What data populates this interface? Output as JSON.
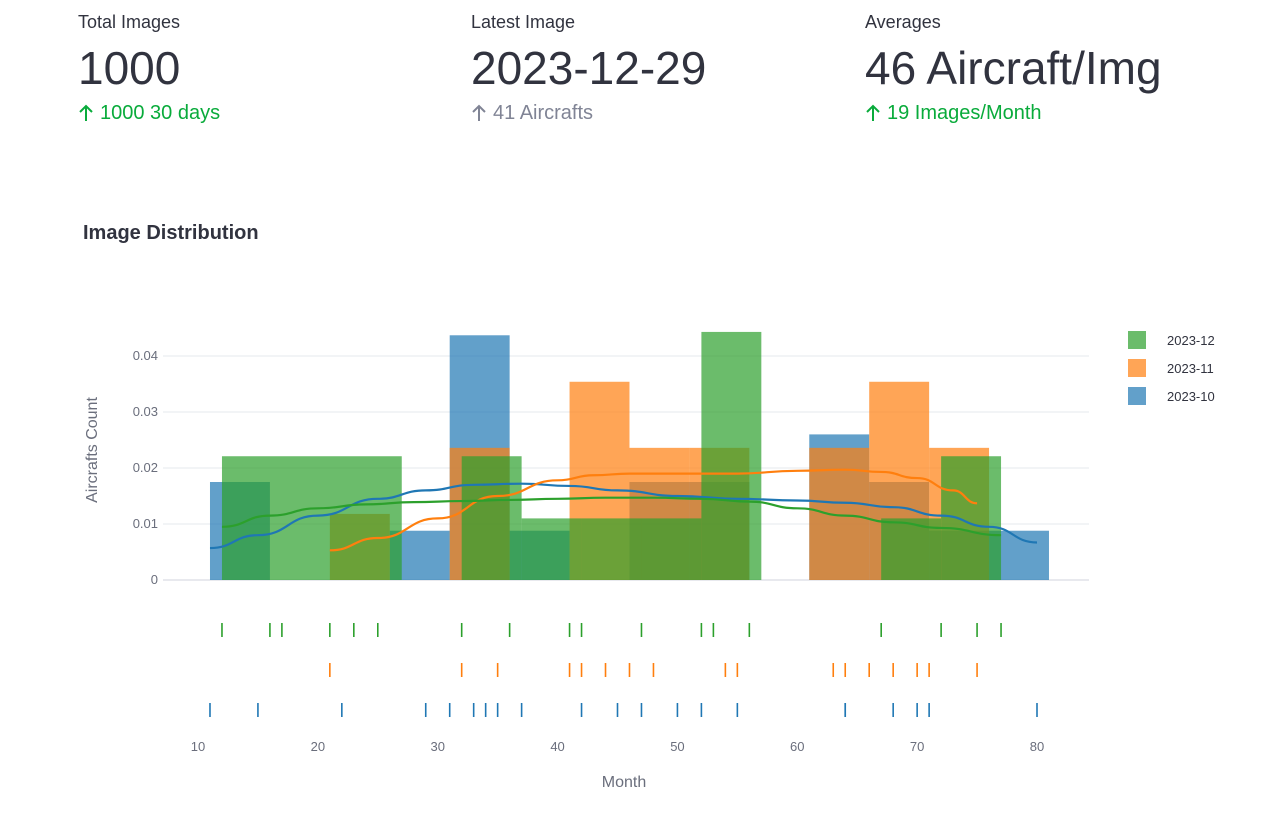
{
  "metrics": [
    {
      "label": "Total Images",
      "value": "1000",
      "delta": "1000 30 days",
      "delta_state": "up-green"
    },
    {
      "label": "Latest Image",
      "value": "2023-12-29",
      "delta": "41 Aircrafts",
      "delta_state": "off"
    },
    {
      "label": "Averages",
      "value": "46 Aircraft/Img",
      "delta": "19 Images/Month",
      "delta_state": "up-green"
    }
  ],
  "section_title": "Image Distribution",
  "colors": {
    "2023-12": "#2ca02c",
    "2023-11": "#ff7f0e",
    "2023-10": "#1f77b4",
    "delta_green": "#09ab3b",
    "delta_gray": "#808495"
  },
  "chart_data": {
    "type": "bar",
    "subtype": "histogram with density curves and rug plot",
    "title": "",
    "xlabel": "Month",
    "ylabel": "Aircrafts Count",
    "xlim": [
      5,
      84
    ],
    "ylim": [
      0,
      0.046
    ],
    "xticks": [
      10,
      20,
      30,
      40,
      50,
      60,
      70,
      80
    ],
    "yticks": [
      0,
      0.01,
      0.02,
      0.03,
      0.04
    ],
    "ytick_labels": [
      "0",
      "0.01",
      "0.02",
      "0.03",
      "0.04"
    ],
    "grid": true,
    "legend_position": "top-right",
    "series": [
      {
        "name": "2023-10",
        "bins": [
          {
            "x0": 11,
            "x1": 16,
            "y": 0.0175
          },
          {
            "x0": 16,
            "x1": 21,
            "y": 0.0
          },
          {
            "x0": 21,
            "x1": 26,
            "y": 0.0
          },
          {
            "x0": 26,
            "x1": 31,
            "y": 0.0088
          },
          {
            "x0": 31,
            "x1": 36,
            "y": 0.0437
          },
          {
            "x0": 36,
            "x1": 41,
            "y": 0.0088
          },
          {
            "x0": 41,
            "x1": 46,
            "y": 0.0
          },
          {
            "x0": 46,
            "x1": 51,
            "y": 0.0175
          },
          {
            "x0": 51,
            "x1": 56,
            "y": 0.0175
          },
          {
            "x0": 56,
            "x1": 61,
            "y": 0.0
          },
          {
            "x0": 61,
            "x1": 66,
            "y": 0.026
          },
          {
            "x0": 66,
            "x1": 71,
            "y": 0.0175
          },
          {
            "x0": 71,
            "x1": 76,
            "y": 0.0088
          },
          {
            "x0": 76,
            "x1": 81,
            "y": 0.0088
          }
        ],
        "curve_x": [
          11,
          15,
          20,
          25,
          29,
          33,
          37,
          41,
          45,
          50,
          55,
          60,
          64,
          68,
          72,
          76,
          80
        ],
        "curve_y": [
          0.0057,
          0.008,
          0.0115,
          0.0145,
          0.016,
          0.017,
          0.0172,
          0.0168,
          0.016,
          0.015,
          0.0145,
          0.0142,
          0.0138,
          0.013,
          0.0115,
          0.0095,
          0.0067
        ],
        "rug": [
          11,
          15,
          22,
          29,
          31,
          33,
          34,
          35,
          37,
          42,
          45,
          47,
          50,
          52,
          55,
          64,
          64,
          68,
          70,
          71,
          80
        ]
      },
      {
        "name": "2023-11",
        "bins": [
          {
            "x0": 21,
            "x1": 26,
            "y": 0.0118
          },
          {
            "x0": 26,
            "x1": 31,
            "y": 0.0
          },
          {
            "x0": 31,
            "x1": 36,
            "y": 0.0236
          },
          {
            "x0": 36,
            "x1": 41,
            "y": 0.0
          },
          {
            "x0": 41,
            "x1": 46,
            "y": 0.0354
          },
          {
            "x0": 46,
            "x1": 51,
            "y": 0.0236
          },
          {
            "x0": 51,
            "x1": 56,
            "y": 0.0236
          },
          {
            "x0": 56,
            "x1": 61,
            "y": 0.0
          },
          {
            "x0": 61,
            "x1": 66,
            "y": 0.0236
          },
          {
            "x0": 66,
            "x1": 71,
            "y": 0.0354
          },
          {
            "x0": 71,
            "x1": 76,
            "y": 0.0236
          }
        ],
        "curve_x": [
          21,
          25,
          30,
          35,
          40,
          43,
          46,
          50,
          55,
          60,
          64,
          67,
          70,
          73,
          75
        ],
        "curve_y": [
          0.0053,
          0.0075,
          0.011,
          0.015,
          0.0178,
          0.0187,
          0.019,
          0.019,
          0.019,
          0.0195,
          0.0197,
          0.0193,
          0.0182,
          0.016,
          0.0137
        ],
        "rug": [
          21,
          32,
          35,
          41,
          42,
          44,
          46,
          48,
          54,
          55,
          63,
          64,
          66,
          68,
          70,
          71,
          75
        ]
      },
      {
        "name": "2023-12",
        "bins": [
          {
            "x0": 12,
            "x1": 27,
            "y": 0.0221
          },
          {
            "x0": 27,
            "x1": 32,
            "y": 0.0
          },
          {
            "x0": 32,
            "x1": 37,
            "y": 0.0221
          },
          {
            "x0": 37,
            "x1": 42,
            "y": 0.011
          },
          {
            "x0": 42,
            "x1": 47,
            "y": 0.011
          },
          {
            "x0": 47,
            "x1": 52,
            "y": 0.011
          },
          {
            "x0": 52,
            "x1": 57,
            "y": 0.0443
          },
          {
            "x0": 57,
            "x1": 62,
            "y": 0.0
          },
          {
            "x0": 62,
            "x1": 67,
            "y": 0.0
          },
          {
            "x0": 67,
            "x1": 72,
            "y": 0.011
          },
          {
            "x0": 72,
            "x1": 77,
            "y": 0.0221
          }
        ],
        "curve_x": [
          12,
          16,
          20,
          24,
          28,
          32,
          36,
          40,
          44,
          48,
          52,
          56,
          60,
          64,
          68,
          72,
          77
        ],
        "curve_y": [
          0.0095,
          0.0115,
          0.0128,
          0.0135,
          0.0139,
          0.0141,
          0.0143,
          0.0145,
          0.0147,
          0.0147,
          0.0145,
          0.014,
          0.0128,
          0.0115,
          0.0103,
          0.0093,
          0.008
        ],
        "rug": [
          12,
          16,
          17,
          21,
          23,
          25,
          32,
          36,
          41,
          42,
          47,
          52,
          53,
          56,
          67,
          72,
          75,
          77
        ]
      }
    ],
    "legend_order": [
      "2023-12",
      "2023-11",
      "2023-10"
    ]
  }
}
